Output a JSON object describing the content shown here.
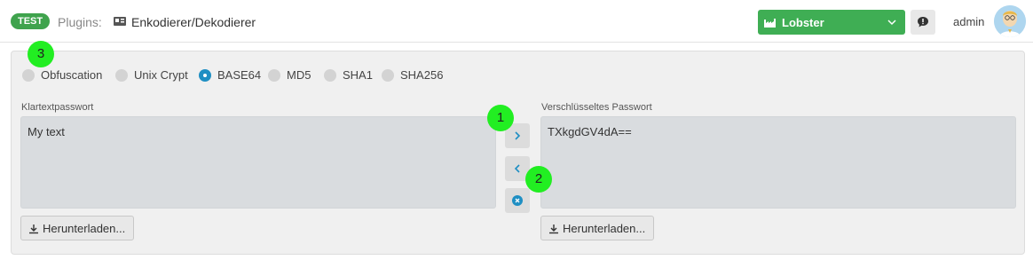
{
  "header": {
    "badge": "TEST",
    "breadcrumb_label": "Plugins:",
    "breadcrumb_icon": "id-card-icon",
    "page_title": "Enkodierer/Dekodierer",
    "environment": "Lobster",
    "environment_icon": "factory-icon",
    "user": "admin"
  },
  "colors": {
    "accent_green": "#3fae54",
    "badge_green": "#3fa34d",
    "radio_selected": "#1f8fc3",
    "marker_green": "#22ee22"
  },
  "methods": [
    {
      "label": "Obfuscation",
      "selected": false
    },
    {
      "label": "Unix Crypt",
      "selected": false
    },
    {
      "label": "BASE64",
      "selected": true
    },
    {
      "label": "MD5",
      "selected": false
    },
    {
      "label": "SHA1",
      "selected": false
    },
    {
      "label": "SHA256",
      "selected": false
    }
  ],
  "plaintext": {
    "label": "Klartextpasswort",
    "value": "My text",
    "download_label": "Herunterladen..."
  },
  "ciphertext": {
    "label": "Verschlüsseltes Passwort",
    "value": "TXkgdGV4dA==",
    "download_label": "Herunterladen..."
  },
  "actions": {
    "encode_icon": "chevron-right-icon",
    "decode_icon": "chevron-left-icon",
    "clear_icon": "close-circle-icon"
  },
  "markers": [
    "1",
    "2",
    "3"
  ]
}
